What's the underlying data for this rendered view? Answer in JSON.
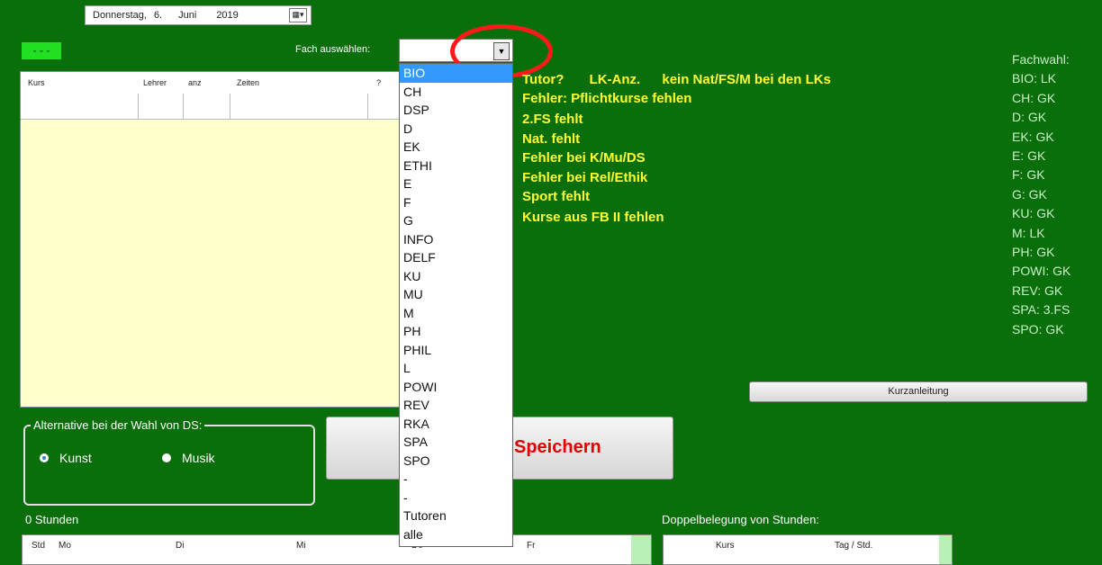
{
  "date_picker": {
    "weekday": "Donnerstag,",
    "day": "6.",
    "month": "Juni",
    "year": "2019",
    "icon": "calendar-icon"
  },
  "dash_button": "- - -",
  "fach_label": "Fach auswählen:",
  "course_grid": {
    "columns": [
      "Kurs",
      "Lehrer",
      "anz",
      "Zeiten",
      "?"
    ]
  },
  "dropdown": {
    "selected": "BIO",
    "options": [
      "BIO",
      "CH",
      "DSP",
      "D",
      "EK",
      "ETHI",
      "E",
      "F",
      "G",
      "INFO",
      "DELF",
      "KU",
      "MU",
      "M",
      "PH",
      "PHIL",
      "L",
      "POWI",
      "REV",
      "RKA",
      "SPA",
      "SPO",
      "-",
      "-",
      "Tutoren",
      "alle"
    ]
  },
  "messages": {
    "line1_a": "Tutor?",
    "line1_b": "LK-Anz.",
    "line1_c": "kein Nat/FS/M bei den LKs",
    "lines": [
      "Fehler: Pflichtkurse fehlen",
      "2.FS fehlt",
      "Nat. fehlt",
      "Fehler bei K/Mu/DS",
      "Fehler bei Rel/Ethik",
      "Sport fehlt",
      "Kurse aus FB II fehlen"
    ]
  },
  "fachwahl": {
    "title": "Fachwahl:",
    "items": [
      "BIO: LK",
      "CH: GK",
      "D: GK",
      "EK: GK",
      "E: GK",
      "F: GK",
      "G: GK",
      "KU: GK",
      "M: LK",
      "PH: GK",
      "POWI: GK",
      "REV: GK",
      "SPA: 3.FS",
      "SPO: GK"
    ]
  },
  "kurzanleitung": "Kurzanleitung",
  "alternative": {
    "title": "Alternative bei der Wahl von DS:",
    "options": [
      "Kunst",
      "Musik"
    ],
    "selected": "Kunst"
  },
  "save_button": "Speichern",
  "stunden_label": "0 Stunden",
  "timetable": {
    "columns": [
      "Std",
      "Mo",
      "Di",
      "Mi",
      "Do",
      "Fr"
    ]
  },
  "doppel": {
    "title": "Doppelbelegung von Stunden:",
    "columns": [
      "Kurs",
      "Tag / Std."
    ]
  },
  "colors": {
    "background": "#0a6e0a",
    "message": "#ffff33",
    "selection": "#3399ff",
    "marker": "#ff1a1a"
  }
}
